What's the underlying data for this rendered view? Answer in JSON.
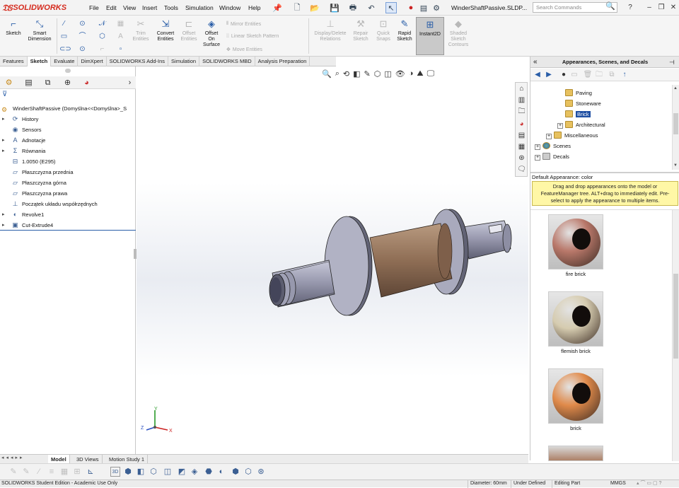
{
  "app": {
    "logo_text": "SOLIDWORKS",
    "menu": [
      "File",
      "Edit",
      "View",
      "Insert",
      "Tools",
      "Simulation",
      "Window",
      "Help"
    ],
    "doc_title": "WinderShaftPassive.SLDP...",
    "search_placeholder": "Search Commands",
    "help_label": "?",
    "colors": {
      "brand": "#d52b1e",
      "accent": "#2a5ea8",
      "tip_bg": "#fff7a6"
    }
  },
  "ribbon": {
    "sketch": "Sketch",
    "smart_dimension": "Smart\nDimension",
    "trim_entities": "Trim\nEntities",
    "convert_entities": "Convert\nEntities",
    "offset_entities": "Offset\nEntities",
    "offset_on_surface": "Offset\nOn\nSurface",
    "mirror_entities": "Mirror Entities",
    "linear_sketch_pattern": "Linear Sketch Pattern",
    "move_entities": "Move Entities",
    "display_delete_relations": "Display/Delete\nRelations",
    "repair_sketch": "Repair\nSketch",
    "quick_snaps": "Quick\nSnaps",
    "rapid_sketch": "Rapid\nSketch",
    "instant2d": "Instant2D",
    "shaded_sketch_contours": "Shaded\nSketch\nContours"
  },
  "command_tabs": [
    "Features",
    "Sketch",
    "Evaluate",
    "DimXpert",
    "SOLIDWORKS Add-Ins",
    "Simulation",
    "SOLIDWORKS MBD",
    "Analysis Preparation"
  ],
  "feature_tree": {
    "root": "WinderShaftPassive  (Domyślna<<Domyślna>_S",
    "items": [
      {
        "label": "History",
        "icon": "history-icon",
        "expand": true
      },
      {
        "label": "Sensors",
        "icon": "sensors-icon",
        "expand": false
      },
      {
        "label": "Adnotacje",
        "icon": "annotations-icon",
        "expand": true
      },
      {
        "label": "Równania",
        "icon": "equations-icon",
        "expand": true
      },
      {
        "label": "1.0050 (E295)",
        "icon": "material-icon",
        "expand": false
      },
      {
        "label": "Płaszczyzna przednia",
        "icon": "plane-icon",
        "expand": false
      },
      {
        "label": "Płaszczyzna górna",
        "icon": "plane-icon",
        "expand": false
      },
      {
        "label": "Płaszczyzna prawa",
        "icon": "plane-icon",
        "expand": false
      },
      {
        "label": "Początek układu współrzędnych",
        "icon": "origin-icon",
        "expand": false
      },
      {
        "label": "Revolve1",
        "icon": "revolve-icon",
        "expand": true
      },
      {
        "label": "Cut-Extrude4",
        "icon": "cut-extrude-icon",
        "expand": true
      }
    ]
  },
  "task_pane": {
    "title": "Appearances, Scenes, and Decals",
    "tree": [
      {
        "label": "Paving",
        "indent": 2,
        "pm": ""
      },
      {
        "label": "Stoneware",
        "indent": 2,
        "pm": ""
      },
      {
        "label": "Brick",
        "indent": 2,
        "pm": "",
        "selected": true
      },
      {
        "label": "Architectural",
        "indent": 2,
        "pm": "+"
      },
      {
        "label": "Miscellaneous",
        "indent": 1,
        "pm": "+"
      },
      {
        "label": "Scenes",
        "indent": 0,
        "pm": "+"
      },
      {
        "label": "Decals",
        "indent": 0,
        "pm": "+"
      }
    ],
    "default_appearance": "Default Appearance: color",
    "tip": "Drag and drop appearances onto the model or FeatureManager tree.  ALT+drag to immediately edit. Pre-select to apply the appearance to multiple items.",
    "swatches": [
      {
        "label": "fire brick",
        "color": "#b9786a"
      },
      {
        "label": "flemish brick",
        "color": "#d6ccb0"
      },
      {
        "label": "brick",
        "color": "#e08a4a"
      }
    ]
  },
  "bottom_tabs": [
    "Model",
    "3D Views",
    "Motion Study 1"
  ],
  "triad": {
    "x": "X",
    "y": "Y",
    "z": "Z"
  },
  "status": {
    "edition": "SOLIDWORKS Student Edition - Academic Use Only",
    "diameter": "Diameter: 60mm",
    "defined": "Under Defined",
    "editing": "Editing Part",
    "units": "MMGS"
  }
}
